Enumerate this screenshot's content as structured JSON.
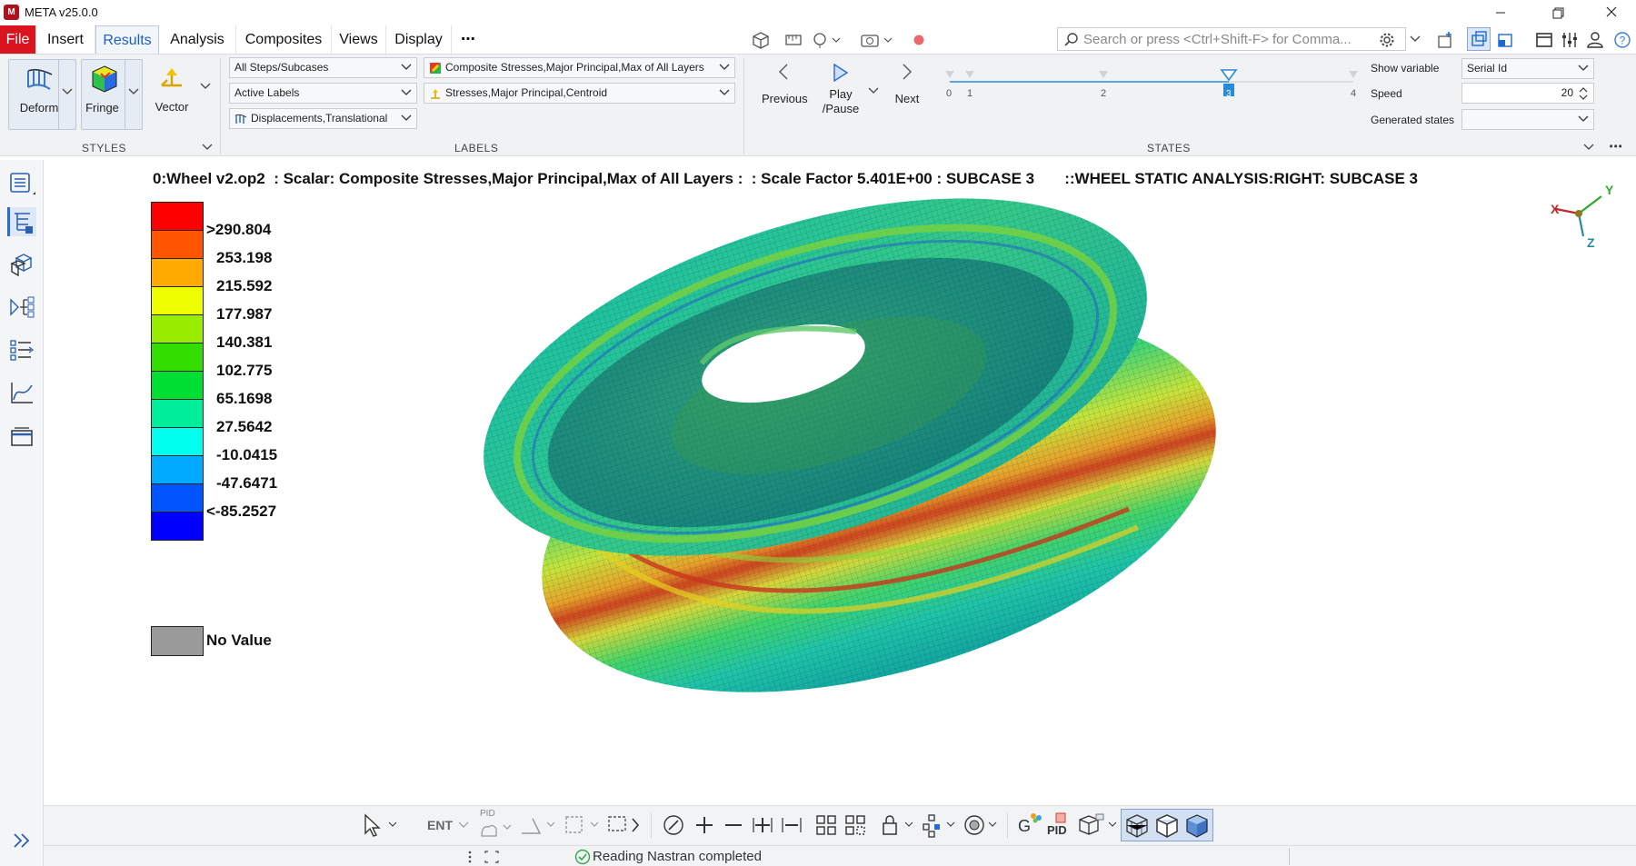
{
  "window": {
    "title": "META v25.0.0"
  },
  "menu": {
    "tabs": [
      "File",
      "Insert",
      "Results",
      "Analysis",
      "Composites",
      "Views",
      "Display"
    ],
    "more": "⋯",
    "active": "Results"
  },
  "search": {
    "placeholder": "Search or press <Ctrl+Shift-F> for Comma..."
  },
  "ribbon": {
    "styles": {
      "group_label": "STYLES",
      "deform_label": "Deform",
      "fringe_label": "Fringe",
      "vector_label": "Vector"
    },
    "labels": {
      "group_label": "LABELS",
      "steps_combo": "All Steps/Subcases",
      "active_labels_combo": "Active Labels",
      "displacements_combo": "Displacements,Translational",
      "fringe_result_combo": "Composite Stresses,Major Principal,Max of All Layers",
      "vector_result_combo": "Stresses,Major Principal,Centroid"
    },
    "states": {
      "group_label": "STATES",
      "previous_label": "Previous",
      "play_label": "Play\n/Pause",
      "next_label": "Next",
      "ticks": [
        "0",
        "1",
        "2",
        "3",
        "4"
      ],
      "current_state": "3",
      "show_variable_label": "Show variable",
      "show_variable_value": "Serial Id",
      "speed_label": "Speed",
      "speed_value": "20",
      "generated_states_label": "Generated states",
      "generated_states_value": ""
    }
  },
  "viewport": {
    "header": "0:Wheel v2.op2  : Scalar: Composite Stresses,Major Principal,Max of All Layers :  : Scale Factor 5.401E+00 : SUBCASE 3       ::WHEEL STATIC ANALYSIS:RIGHT: SUBCASE 3",
    "axis_labels": {
      "x": "X",
      "y": "Y",
      "z": "Z"
    },
    "legend": {
      "colors": [
        "#ff0000",
        "#ff5500",
        "#ffaa00",
        "#eeff00",
        "#99ee00",
        "#33dd00",
        "#00dd33",
        "#00ee99",
        "#00ffee",
        "#00aaff",
        "#0055ff",
        "#0000ff"
      ],
      "labels": [
        ">290.804",
        "253.198",
        "215.592",
        "177.987",
        "140.381",
        "102.775",
        "65.1698",
        "27.5642",
        "-10.0415",
        "-47.6471",
        "<-85.2527"
      ],
      "no_value_color": "#9a9a9a",
      "no_value_label": "No Value"
    }
  },
  "bottom_toolbar": {
    "ent_label": "ENT",
    "pid_label": "PID",
    "g_label": "G",
    "pid2_label": "PID"
  },
  "status": {
    "text": "Reading Nastran completed"
  }
}
